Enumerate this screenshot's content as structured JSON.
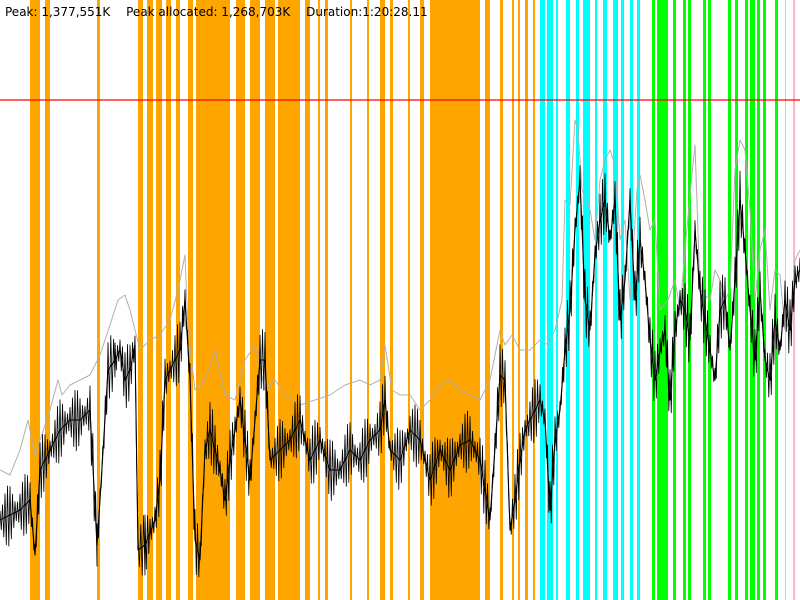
{
  "header": {
    "peak": "Peak: 1,377,551K",
    "peak_allocated": "Peak allocated: 1,268,703K",
    "duration": "Duration:1:20:28.11"
  },
  "chart_data": {
    "type": "line",
    "title": "",
    "xlabel": "",
    "ylabel": "",
    "grid": false,
    "legend": "none",
    "x_unit": "seconds",
    "x_range": [
      0,
      4828.11
    ],
    "y_unit": "K",
    "y_range": [
      0,
      1377551
    ],
    "ylim": [
      0,
      1377551
    ],
    "peak_line_value": 1377551,
    "colors": {
      "orange": "#FFA500",
      "cyan": "#00FFFF",
      "green": "#00FF00",
      "pink": "#FFB6C1",
      "peak": "#FF0000",
      "heap": "#B0B0B0",
      "allocated": "#000000"
    },
    "event_bands": [
      {
        "color": "orange",
        "x_start": 30,
        "x_end": 40
      },
      {
        "color": "orange",
        "x_start": 45,
        "x_end": 50
      },
      {
        "color": "orange",
        "x_start": 97,
        "x_end": 100
      },
      {
        "color": "orange",
        "x_start": 138,
        "x_end": 143
      },
      {
        "color": "orange",
        "x_start": 147,
        "x_end": 153
      },
      {
        "color": "orange",
        "x_start": 156,
        "x_end": 162
      },
      {
        "color": "orange",
        "x_start": 166,
        "x_end": 171
      },
      {
        "color": "orange",
        "x_start": 176,
        "x_end": 180
      },
      {
        "color": "orange",
        "x_start": 188,
        "x_end": 193
      },
      {
        "color": "orange",
        "x_start": 196,
        "x_end": 230
      },
      {
        "color": "orange",
        "x_start": 236,
        "x_end": 245
      },
      {
        "color": "orange",
        "x_start": 250,
        "x_end": 260
      },
      {
        "color": "orange",
        "x_start": 265,
        "x_end": 275
      },
      {
        "color": "orange",
        "x_start": 278,
        "x_end": 300
      },
      {
        "color": "orange",
        "x_start": 305,
        "x_end": 310
      },
      {
        "color": "orange",
        "x_start": 318,
        "x_end": 320
      },
      {
        "color": "orange",
        "x_start": 325,
        "x_end": 328
      },
      {
        "color": "orange",
        "x_start": 350,
        "x_end": 352
      },
      {
        "color": "orange",
        "x_start": 367,
        "x_end": 369
      },
      {
        "color": "orange",
        "x_start": 380,
        "x_end": 385
      },
      {
        "color": "orange",
        "x_start": 390,
        "x_end": 393
      },
      {
        "color": "orange",
        "x_start": 408,
        "x_end": 410
      },
      {
        "color": "orange",
        "x_start": 420,
        "x_end": 424
      },
      {
        "color": "orange",
        "x_start": 430,
        "x_end": 480
      },
      {
        "color": "orange",
        "x_start": 485,
        "x_end": 490
      },
      {
        "color": "orange",
        "x_start": 500,
        "x_end": 503
      },
      {
        "color": "orange",
        "x_start": 512,
        "x_end": 514
      },
      {
        "color": "orange",
        "x_start": 518,
        "x_end": 520
      },
      {
        "color": "orange",
        "x_start": 525,
        "x_end": 528
      },
      {
        "color": "orange",
        "x_start": 533,
        "x_end": 535
      },
      {
        "color": "cyan",
        "x_start": 540,
        "x_end": 545
      },
      {
        "color": "cyan",
        "x_start": 547,
        "x_end": 553
      },
      {
        "color": "cyan",
        "x_start": 556,
        "x_end": 558
      },
      {
        "color": "cyan",
        "x_start": 566,
        "x_end": 570
      },
      {
        "color": "cyan",
        "x_start": 576,
        "x_end": 579
      },
      {
        "color": "cyan",
        "x_start": 583,
        "x_end": 590
      },
      {
        "color": "cyan",
        "x_start": 595,
        "x_end": 597
      },
      {
        "color": "cyan",
        "x_start": 603,
        "x_end": 607
      },
      {
        "color": "cyan",
        "x_start": 613,
        "x_end": 618
      },
      {
        "color": "cyan",
        "x_start": 621,
        "x_end": 624
      },
      {
        "color": "cyan",
        "x_start": 630,
        "x_end": 633
      },
      {
        "color": "cyan",
        "x_start": 637,
        "x_end": 640
      },
      {
        "color": "green",
        "x_start": 652,
        "x_end": 655
      },
      {
        "color": "green",
        "x_start": 657,
        "x_end": 668
      },
      {
        "color": "green",
        "x_start": 673,
        "x_end": 676
      },
      {
        "color": "green",
        "x_start": 683,
        "x_end": 686
      },
      {
        "color": "green",
        "x_start": 688,
        "x_end": 691
      },
      {
        "color": "green",
        "x_start": 703,
        "x_end": 706
      },
      {
        "color": "green",
        "x_start": 708,
        "x_end": 711
      },
      {
        "color": "green",
        "x_start": 728,
        "x_end": 731
      },
      {
        "color": "green",
        "x_start": 735,
        "x_end": 738
      },
      {
        "color": "green",
        "x_start": 745,
        "x_end": 748
      },
      {
        "color": "green",
        "x_start": 750,
        "x_end": 755
      },
      {
        "color": "green",
        "x_start": 757,
        "x_end": 760
      },
      {
        "color": "green",
        "x_start": 763,
        "x_end": 766
      },
      {
        "color": "green",
        "x_start": 775,
        "x_end": 778
      },
      {
        "color": "pink",
        "x_start": 785,
        "x_end": 786
      },
      {
        "color": "pink",
        "x_start": 793,
        "x_end": 795
      }
    ],
    "series": [
      {
        "color": "heap",
        "points": [
          [
            0,
            470
          ],
          [
            10,
            475
          ],
          [
            20,
            450
          ],
          [
            28,
            420
          ],
          [
            35,
            455
          ],
          [
            40,
            440
          ],
          [
            50,
            410
          ],
          [
            58,
            380
          ],
          [
            62,
            395
          ],
          [
            70,
            385
          ],
          [
            80,
            380
          ],
          [
            90,
            375
          ],
          [
            100,
            355
          ],
          [
            110,
            325
          ],
          [
            118,
            300
          ],
          [
            125,
            295
          ],
          [
            130,
            310
          ],
          [
            135,
            330
          ],
          [
            140,
            350
          ],
          [
            150,
            340
          ],
          [
            160,
            335
          ],
          [
            170,
            320
          ],
          [
            178,
            290
          ],
          [
            185,
            255
          ],
          [
            188,
            330
          ],
          [
            195,
            390
          ],
          [
            205,
            380
          ],
          [
            215,
            350
          ],
          [
            225,
            395
          ],
          [
            235,
            400
          ],
          [
            245,
            360
          ],
          [
            255,
            345
          ],
          [
            265,
            390
          ],
          [
            275,
            380
          ],
          [
            285,
            395
          ],
          [
            300,
            405
          ],
          [
            315,
            400
          ],
          [
            330,
            395
          ],
          [
            345,
            385
          ],
          [
            360,
            380
          ],
          [
            370,
            385
          ],
          [
            380,
            380
          ],
          [
            385,
            345
          ],
          [
            392,
            390
          ],
          [
            400,
            395
          ],
          [
            410,
            395
          ],
          [
            420,
            410
          ],
          [
            430,
            400
          ],
          [
            440,
            385
          ],
          [
            450,
            380
          ],
          [
            460,
            390
          ],
          [
            470,
            395
          ],
          [
            480,
            400
          ],
          [
            490,
            380
          ],
          [
            500,
            330
          ],
          [
            505,
            345
          ],
          [
            512,
            335
          ],
          [
            520,
            350
          ],
          [
            530,
            350
          ],
          [
            540,
            340
          ],
          [
            548,
            345
          ],
          [
            555,
            330
          ],
          [
            562,
            300
          ],
          [
            565,
            200
          ],
          [
            570,
            205
          ],
          [
            575,
            120
          ],
          [
            578,
            130
          ],
          [
            582,
            190
          ],
          [
            590,
            210
          ],
          [
            595,
            240
          ],
          [
            600,
            180
          ],
          [
            605,
            160
          ],
          [
            610,
            150
          ],
          [
            615,
            165
          ],
          [
            620,
            240
          ],
          [
            625,
            220
          ],
          [
            630,
            300
          ],
          [
            637,
            190
          ],
          [
            640,
            175
          ],
          [
            645,
            200
          ],
          [
            650,
            230
          ],
          [
            655,
            220
          ],
          [
            660,
            310
          ],
          [
            668,
            300
          ],
          [
            675,
            280
          ],
          [
            680,
            310
          ],
          [
            685,
            250
          ],
          [
            690,
            195
          ],
          [
            695,
            145
          ],
          [
            700,
            290
          ],
          [
            710,
            300
          ],
          [
            715,
            270
          ],
          [
            720,
            280
          ],
          [
            725,
            300
          ],
          [
            730,
            290
          ],
          [
            735,
            170
          ],
          [
            740,
            140
          ],
          [
            745,
            150
          ],
          [
            750,
            210
          ],
          [
            755,
            300
          ],
          [
            760,
            250
          ],
          [
            765,
            230
          ],
          [
            770,
            310
          ],
          [
            775,
            270
          ],
          [
            780,
            275
          ],
          [
            785,
            330
          ],
          [
            790,
            320
          ],
          [
            795,
            260
          ],
          [
            800,
            250
          ]
        ]
      },
      {
        "color": "allocated",
        "points": [
          [
            0,
            520
          ],
          [
            10,
            515
          ],
          [
            20,
            510
          ],
          [
            30,
            500
          ],
          [
            35,
            555
          ],
          [
            40,
            470
          ],
          [
            50,
            450
          ],
          [
            60,
            430
          ],
          [
            70,
            420
          ],
          [
            80,
            420
          ],
          [
            90,
            410
          ],
          [
            97,
            545
          ],
          [
            100,
            500
          ],
          [
            108,
            370
          ],
          [
            115,
            360
          ],
          [
            120,
            350
          ],
          [
            125,
            380
          ],
          [
            130,
            370
          ],
          [
            135,
            345
          ],
          [
            138,
            550
          ],
          [
            145,
            545
          ],
          [
            155,
            520
          ],
          [
            160,
            480
          ],
          [
            165,
            380
          ],
          [
            170,
            370
          ],
          [
            175,
            360
          ],
          [
            180,
            350
          ],
          [
            185,
            300
          ],
          [
            190,
            380
          ],
          [
            195,
            540
          ],
          [
            200,
            560
          ],
          [
            205,
            450
          ],
          [
            210,
            430
          ],
          [
            220,
            470
          ],
          [
            225,
            500
          ],
          [
            230,
            460
          ],
          [
            240,
            400
          ],
          [
            250,
            480
          ],
          [
            260,
            360
          ],
          [
            265,
            360
          ],
          [
            270,
            460
          ],
          [
            280,
            450
          ],
          [
            290,
            440
          ],
          [
            300,
            420
          ],
          [
            310,
            460
          ],
          [
            320,
            440
          ],
          [
            330,
            470
          ],
          [
            340,
            470
          ],
          [
            350,
            450
          ],
          [
            360,
            460
          ],
          [
            370,
            440
          ],
          [
            380,
            430
          ],
          [
            385,
            400
          ],
          [
            390,
            450
          ],
          [
            400,
            460
          ],
          [
            410,
            430
          ],
          [
            420,
            440
          ],
          [
            430,
            480
          ],
          [
            440,
            450
          ],
          [
            450,
            470
          ],
          [
            460,
            445
          ],
          [
            470,
            440
          ],
          [
            480,
            460
          ],
          [
            490,
            520
          ],
          [
            500,
            375
          ],
          [
            505,
            380
          ],
          [
            510,
            530
          ],
          [
            515,
            500
          ],
          [
            520,
            460
          ],
          [
            525,
            430
          ],
          [
            530,
            420
          ],
          [
            540,
            400
          ],
          [
            545,
            420
          ],
          [
            550,
            510
          ],
          [
            555,
            440
          ],
          [
            560,
            410
          ],
          [
            565,
            350
          ],
          [
            570,
            310
          ],
          [
            575,
            230
          ],
          [
            580,
            180
          ],
          [
            585,
            300
          ],
          [
            590,
            330
          ],
          [
            595,
            255
          ],
          [
            600,
            220
          ],
          [
            605,
            200
          ],
          [
            610,
            240
          ],
          [
            615,
            200
          ],
          [
            620,
            320
          ],
          [
            625,
            280
          ],
          [
            630,
            200
          ],
          [
            635,
            300
          ],
          [
            640,
            240
          ],
          [
            645,
            280
          ],
          [
            650,
            340
          ],
          [
            655,
            380
          ],
          [
            660,
            350
          ],
          [
            665,
            330
          ],
          [
            670,
            400
          ],
          [
            675,
            330
          ],
          [
            680,
            300
          ],
          [
            685,
            310
          ],
          [
            690,
            340
          ],
          [
            695,
            230
          ],
          [
            700,
            290
          ],
          [
            705,
            320
          ],
          [
            710,
            350
          ],
          [
            715,
            380
          ],
          [
            720,
            310
          ],
          [
            725,
            300
          ],
          [
            730,
            350
          ],
          [
            735,
            280
          ],
          [
            740,
            200
          ],
          [
            745,
            250
          ],
          [
            750,
            310
          ],
          [
            755,
            360
          ],
          [
            760,
            290
          ],
          [
            765,
            360
          ],
          [
            770,
            380
          ],
          [
            775,
            320
          ],
          [
            780,
            350
          ],
          [
            785,
            300
          ],
          [
            790,
            330
          ],
          [
            795,
            280
          ],
          [
            800,
            270
          ]
        ]
      }
    ]
  }
}
